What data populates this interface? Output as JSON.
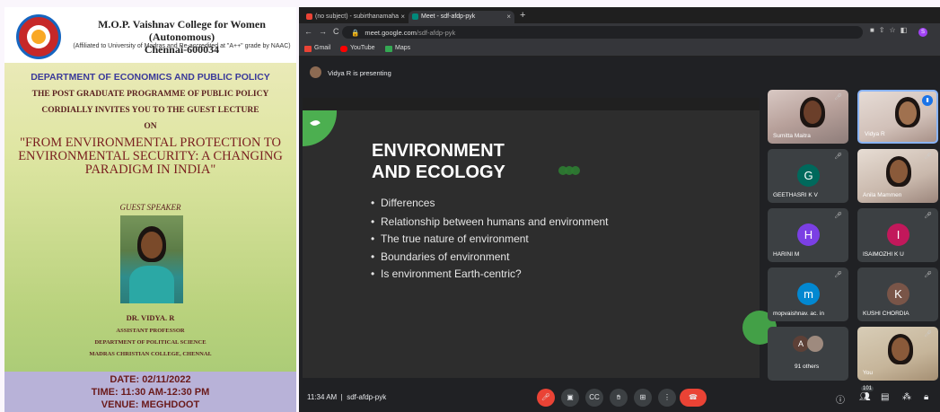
{
  "poster": {
    "college": "M.O.P. Vaishnav College for Women (Autonomous)",
    "city": "Chennai-600034",
    "affiliation": "(Affiliated to University of Madras and Re-accredited at \"A++\" grade by NAAC)",
    "department": "DEPARTMENT OF ECONOMICS AND PUBLIC POLICY",
    "line1": "THE POST GRADUATE PROGRAMME OF PUBLIC POLICY",
    "line2": "CORDIALLY INVITES YOU TO THE GUEST LECTURE",
    "line3": "ON",
    "topic": "\"FROM ENVIRONMENTAL PROTECTION TO ENVIRONMENTAL SECURITY: A CHANGING PARADIGM IN INDIA\"",
    "guest_heading": "GUEST SPEAKER",
    "speaker_name": "DR. VIDYA. R",
    "speaker_role": "ASSISTANT PROFESSOR",
    "speaker_dept": "DEPARTMENT OF POLITICAL SCIENCE",
    "speaker_college": "MADRAS CHRISTIAN COLLEGE, CHENNAI.",
    "date": "DATE: 02/11/2022",
    "time": "TIME: 11:30 AM-12:30 PM",
    "venue": "VENUE: MEGHDOOT"
  },
  "browser": {
    "tabs": [
      {
        "label": "(no subject) - subirthanamaha",
        "color": "#ea4335"
      },
      {
        "label": "Meet - sdf-afdp-pyk",
        "color": "#00897b"
      }
    ],
    "url_host": "meet.google.com",
    "url_path": "/sdf-afdp-pyk",
    "profile_initial": "S",
    "bookmarks": [
      {
        "label": "Gmail",
        "color": "#ea4335"
      },
      {
        "label": "YouTube",
        "color": "#ff0000"
      },
      {
        "label": "Maps",
        "color": "#34a853"
      }
    ]
  },
  "meet": {
    "presenting": "Vidya R is presenting",
    "slide": {
      "title_line1": "ENVIRONMENT",
      "title_line2": "AND ECOLOGY",
      "bullets": [
        "Differences",
        "Relationship between humans and environment",
        "The true nature of environment",
        "Boundaries of environment",
        "Is environment Earth-centric?"
      ]
    },
    "participants": [
      {
        "name": "Sumitta Maitra"
      },
      {
        "name": "Vidya R"
      },
      {
        "name": "GEETHASRI K V",
        "initial": "G",
        "color": "#00695c"
      },
      {
        "name": "Anila Mammen"
      },
      {
        "name": "HARINI M",
        "initial": "H",
        "color": "#7b3fe4"
      },
      {
        "name": "ISAIMOZHI K U",
        "initial": "I",
        "color": "#c2185b"
      },
      {
        "name": "mopvaishnav. ac. in",
        "initial": "m",
        "color": "#0288d1"
      },
      {
        "name": "KUSHI CHORDIA",
        "initial": "K",
        "color": "#795548"
      },
      {
        "name": "91 others",
        "initial": "A",
        "color": "#5d4037"
      },
      {
        "name": "You"
      }
    ],
    "clock": "11:34 AM",
    "meeting_code": "sdf-afdp-pyk",
    "people_count": "101"
  }
}
